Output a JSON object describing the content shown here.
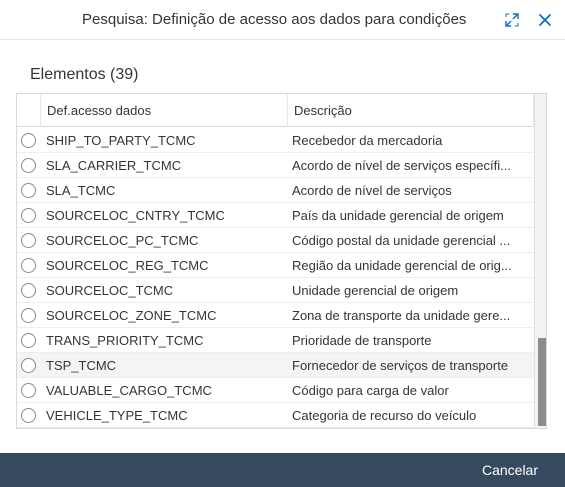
{
  "dialog": {
    "title": "Pesquisa: Definição de acesso aos dados para condições",
    "resize_icon": "resize-icon",
    "close_icon": "close-icon"
  },
  "section": {
    "title": "Elementos (39)"
  },
  "table": {
    "columns": [
      "Def.acesso dados",
      "Descrição"
    ],
    "rows": [
      {
        "def": "SHIP_TO_PARTY_TCMC",
        "desc": "Recebedor da mercadoria"
      },
      {
        "def": "SLA_CARRIER_TCMC",
        "desc": "Acordo de nível de serviços específi..."
      },
      {
        "def": "SLA_TCMC",
        "desc": "Acordo de nível de serviços"
      },
      {
        "def": "SOURCELOC_CNTRY_TCMC",
        "desc": "País da unidade gerencial de origem"
      },
      {
        "def": "SOURCELOC_PC_TCMC",
        "desc": "Código postal da unidade gerencial ..."
      },
      {
        "def": "SOURCELOC_REG_TCMC",
        "desc": "Região da unidade gerencial de orig..."
      },
      {
        "def": "SOURCELOC_TCMC",
        "desc": "Unidade gerencial de origem"
      },
      {
        "def": "SOURCELOC_ZONE_TCMC",
        "desc": "Zona de transporte da unidade gere..."
      },
      {
        "def": "TRANS_PRIORITY_TCMC",
        "desc": "Prioridade de transporte"
      },
      {
        "def": "TSP_TCMC",
        "desc": "Fornecedor de serviços de transporte"
      },
      {
        "def": "VALUABLE_CARGO_TCMC",
        "desc": "Código para carga de valor"
      },
      {
        "def": "VEHICLE_TYPE_TCMC",
        "desc": "Categoria de recurso do veículo"
      }
    ],
    "highlighted_row_index": 9
  },
  "footer": {
    "cancel_label": "Cancelar"
  },
  "colors": {
    "accent": "#0a6ed1",
    "footer_bg": "#354a5f",
    "text": "#32363a"
  }
}
